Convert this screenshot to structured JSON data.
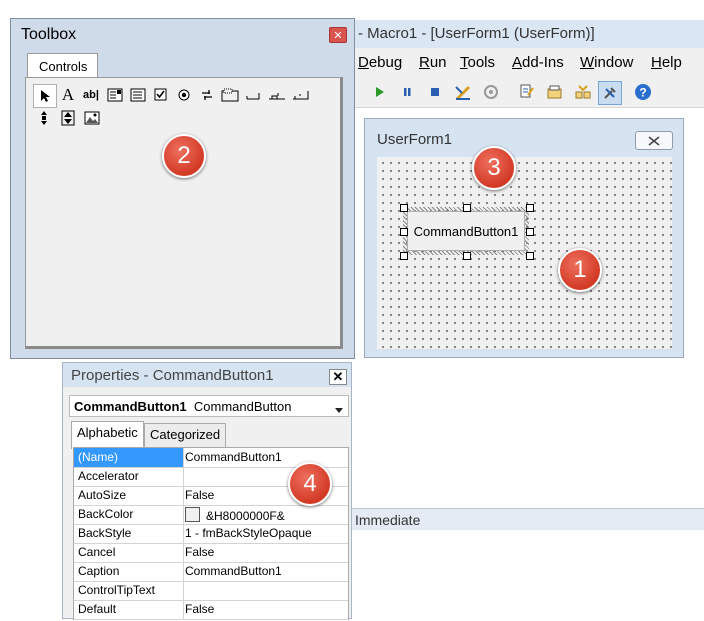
{
  "vba": {
    "title": "- Macro1 - [UserForm1 (UserForm)]",
    "menu": [
      "Debug",
      "Run",
      "Tools",
      "Add-Ins",
      "Window",
      "Help"
    ],
    "menu_mnemonics": [
      "D",
      "R",
      "T",
      "A",
      "W",
      "H"
    ],
    "toolbar_icons": [
      "run-icon",
      "pause-icon",
      "stop-icon",
      "design-mode-icon",
      "project-explorer-icon",
      "properties-window-icon",
      "object-browser-icon",
      "toolbox-icon",
      "help-icon"
    ]
  },
  "userform": {
    "title": "UserForm1",
    "command_button_caption": "CommandButton1"
  },
  "toolbox": {
    "title": "Toolbox",
    "tab_label": "Controls",
    "tools": [
      "select-objects",
      "label",
      "textbox",
      "combobox",
      "listbox",
      "checkbox",
      "optionbutton",
      "togglebutton",
      "frame",
      "commandbutton",
      "tabstrip",
      "multipage",
      "scrollbar",
      "spinbutton",
      "image"
    ]
  },
  "properties": {
    "title": "Properties - CommandButton1",
    "object_name": "CommandButton1",
    "object_type": "CommandButton",
    "tabs": [
      "Alphabetic",
      "Categorized"
    ],
    "rows": [
      {
        "name": "(Name)",
        "value": "CommandButton1"
      },
      {
        "name": "Accelerator",
        "value": ""
      },
      {
        "name": "AutoSize",
        "value": "False"
      },
      {
        "name": "BackColor",
        "value": "&H8000000F&"
      },
      {
        "name": "BackStyle",
        "value": "1 - fmBackStyleOpaque"
      },
      {
        "name": "Cancel",
        "value": "False"
      },
      {
        "name": "Caption",
        "value": "CommandButton1"
      },
      {
        "name": "ControlTipText",
        "value": ""
      },
      {
        "name": "Default",
        "value": "False"
      }
    ]
  },
  "immediate": {
    "title": "Immediate"
  },
  "callouts": [
    "1",
    "2",
    "3",
    "4"
  ],
  "colors": {
    "callout": "#d23a25",
    "selected_row": "#3399ff",
    "form_frame": "#d6e3f1"
  }
}
